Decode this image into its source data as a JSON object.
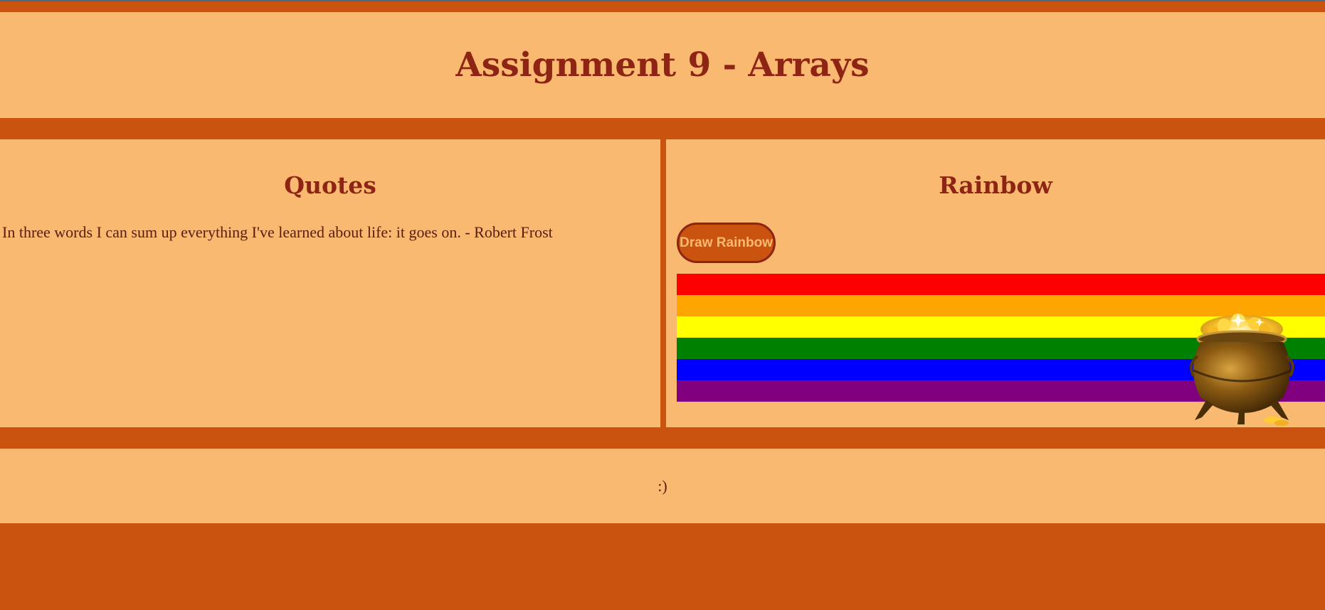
{
  "header": {
    "title": "Assignment 9 - Arrays"
  },
  "quotes": {
    "heading": "Quotes",
    "text": "In three words I can sum up everything I've learned about life: it goes on. - Robert Frost"
  },
  "rainbow": {
    "heading": "Rainbow",
    "button_label": "Draw Rainbow",
    "colors": [
      "#ff0000",
      "#ffa500",
      "#ffff00",
      "#008000",
      "#0000ff",
      "#800080"
    ],
    "pot_icon": "pot-of-gold-icon"
  },
  "footer": {
    "text": ":)"
  },
  "theme": {
    "background": "#c9530f",
    "panel": "#fab971",
    "heading": "#8e2414"
  }
}
